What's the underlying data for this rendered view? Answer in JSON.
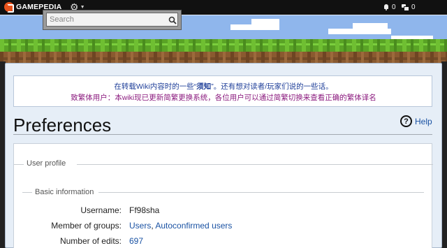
{
  "topbar": {
    "logo_text": "GAMEPEDIA",
    "gear_icon": "gear-icon",
    "notifications_count": "0",
    "messages_count": "0"
  },
  "search": {
    "placeholder": "Search"
  },
  "notice": {
    "line1_prefix": "在转载Wiki内容时的一些“",
    "line1_bold": "须知",
    "line1_suffix": "”。还有想对读者/玩家们说的一些话。",
    "line2": "致繁体用户：本wiki现已更新简繁更换系统，各位用户可以通过简繁切换来查看正确的繁体译名",
    "colors": {
      "line1": "#1f3f99",
      "line2": "#8b1a7e"
    }
  },
  "page": {
    "title": "Preferences",
    "help_label": "Help"
  },
  "preferences": {
    "section_legend": "User profile",
    "subsection_legend": "Basic information",
    "username_label": "Username:",
    "username_value": "Ff98sha",
    "groups_label": "Member of groups:",
    "group_1": "Users",
    "group_separator": ", ",
    "group_2": "Autoconfirmed users",
    "edits_label": "Number of edits:",
    "edits_value": "697"
  }
}
